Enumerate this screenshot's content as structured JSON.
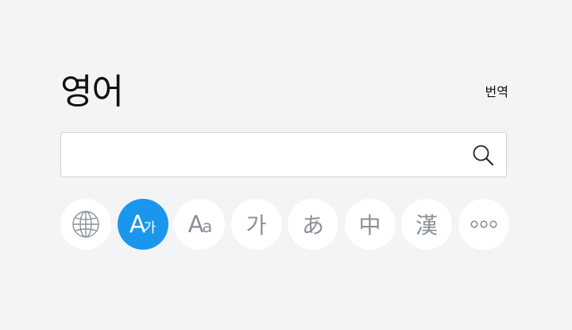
{
  "header": {
    "title": "영어",
    "translate_label": "번역"
  },
  "search": {
    "value": "",
    "placeholder": "",
    "icon": "search-icon"
  },
  "dictionaries": [
    {
      "name": "all-dictionaries",
      "icon": "globe-icon",
      "active": false
    },
    {
      "name": "english-korean",
      "label": "A",
      "label_small": "가",
      "active": true
    },
    {
      "name": "english-english",
      "label": "A",
      "label_small": "a",
      "active": false
    },
    {
      "name": "korean",
      "label": "가",
      "active": false
    },
    {
      "name": "japanese",
      "label": "あ",
      "active": false
    },
    {
      "name": "chinese",
      "label": "中",
      "active": false
    },
    {
      "name": "hanja",
      "label": "漢",
      "active": false
    },
    {
      "name": "more",
      "icon": "more-dots-icon",
      "active": false
    }
  ],
  "colors": {
    "background": "#f3f4f6",
    "accent": "#1a97ec",
    "icon_gray": "#8a9099"
  }
}
